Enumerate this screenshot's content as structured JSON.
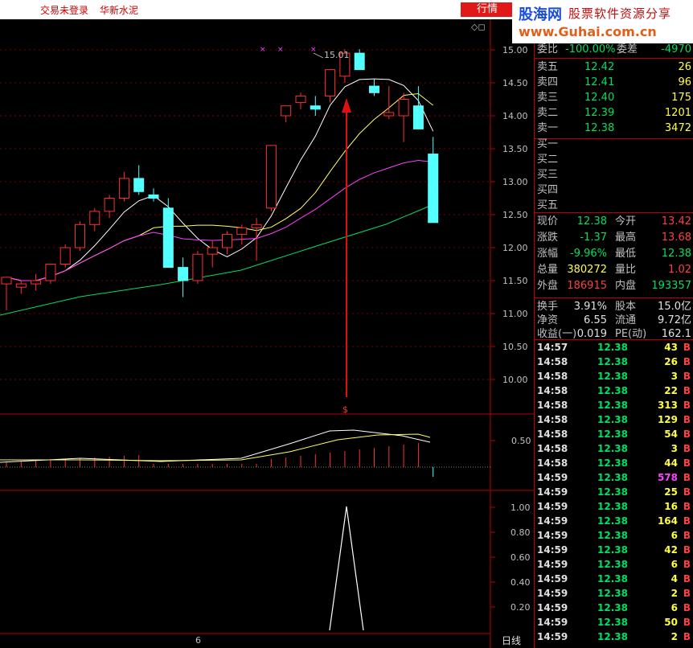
{
  "topbar": {
    "login_status": "交易未登录",
    "stock_name": "华新水泥",
    "button_label": "行情"
  },
  "banner": {
    "logo": "股海网",
    "slogan": "股票软件资源分享",
    "url": "www.Guhai.com.cn"
  },
  "chart": {
    "price_axis": [
      "15.00",
      "14.50",
      "14.00",
      "13.50",
      "13.00",
      "12.50",
      "12.00",
      "11.50",
      "11.00",
      "10.50",
      "10.00"
    ],
    "high_label": "15.01",
    "signal_mark": "$",
    "macd_axis": [
      "0.50"
    ],
    "indicator_axis": [
      "1.00",
      "0.80",
      "0.60",
      "0.40",
      "0.20"
    ],
    "date_label": "6",
    "period_label": "日线",
    "colors": {
      "up": "#ff3030",
      "down": "#54ffff",
      "ma5": "#ffffff",
      "ma10": "#ffff60",
      "ma20": "#ff40ff",
      "ma60": "#00e060"
    }
  },
  "quote": {
    "weibi": {
      "label": "委比",
      "value": "-100.00%",
      "label2": "委差",
      "value2": "-4970"
    },
    "asks": [
      {
        "label": "卖五",
        "price": "12.42",
        "vol": "26"
      },
      {
        "label": "卖四",
        "price": "12.41",
        "vol": "96"
      },
      {
        "label": "卖三",
        "price": "12.40",
        "vol": "175"
      },
      {
        "label": "卖二",
        "price": "12.39",
        "vol": "1201"
      },
      {
        "label": "卖一",
        "price": "12.38",
        "vol": "3472"
      }
    ],
    "bids": [
      {
        "label": "买一"
      },
      {
        "label": "买二"
      },
      {
        "label": "买三"
      },
      {
        "label": "买四"
      },
      {
        "label": "买五"
      }
    ],
    "stats": [
      {
        "l1": "现价",
        "v1": "12.38",
        "l2": "今开",
        "v2": "13.42"
      },
      {
        "l1": "涨跌",
        "v1": "-1.37",
        "l2": "最高",
        "v2": "13.68"
      },
      {
        "l1": "涨幅",
        "v1": "-9.96%",
        "l2": "最低",
        "v2": "12.38"
      },
      {
        "l1": "总量",
        "v1": "380272",
        "l2": "量比",
        "v2": "1.02"
      },
      {
        "l1": "外盘",
        "v1": "186915",
        "l2": "内盘",
        "v2": "193357"
      }
    ],
    "fund": [
      {
        "l1": "换手",
        "v1": "3.91%",
        "l2": "股本",
        "v2": "15.0亿"
      },
      {
        "l1": "净资",
        "v1": "6.55",
        "l2": "流通",
        "v2": "9.72亿"
      },
      {
        "l1": "收益(一)",
        "v1": "0.019",
        "l2": "PE(动)",
        "v2": "162.1"
      }
    ]
  },
  "ticks": [
    {
      "time": "14:57",
      "price": "12.38",
      "vol": "43",
      "side": "B"
    },
    {
      "time": "14:58",
      "price": "12.38",
      "vol": "26",
      "side": "B"
    },
    {
      "time": "14:58",
      "price": "12.38",
      "vol": "3",
      "side": "B"
    },
    {
      "time": "14:58",
      "price": "12.38",
      "vol": "22",
      "side": "B"
    },
    {
      "time": "14:58",
      "price": "12.38",
      "vol": "313",
      "side": "B"
    },
    {
      "time": "14:58",
      "price": "12.38",
      "vol": "129",
      "side": "B"
    },
    {
      "time": "14:58",
      "price": "12.38",
      "vol": "54",
      "side": "B"
    },
    {
      "time": "14:58",
      "price": "12.38",
      "vol": "3",
      "side": "B"
    },
    {
      "time": "14:58",
      "price": "12.38",
      "vol": "44",
      "side": "B"
    },
    {
      "time": "14:59",
      "price": "12.38",
      "vol": "578",
      "side": "B"
    },
    {
      "time": "14:59",
      "price": "12.38",
      "vol": "25",
      "side": "B"
    },
    {
      "time": "14:59",
      "price": "12.38",
      "vol": "16",
      "side": "B"
    },
    {
      "time": "14:59",
      "price": "12.38",
      "vol": "164",
      "side": "B"
    },
    {
      "time": "14:59",
      "price": "12.38",
      "vol": "6",
      "side": "B"
    },
    {
      "time": "14:59",
      "price": "12.38",
      "vol": "42",
      "side": "B"
    },
    {
      "time": "14:59",
      "price": "12.38",
      "vol": "6",
      "side": "B"
    },
    {
      "time": "14:59",
      "price": "12.38",
      "vol": "4",
      "side": "B"
    },
    {
      "time": "14:59",
      "price": "12.38",
      "vol": "2",
      "side": "B"
    },
    {
      "time": "14:59",
      "price": "12.38",
      "vol": "6",
      "side": "B"
    },
    {
      "time": "14:59",
      "price": "12.38",
      "vol": "50",
      "side": "B"
    },
    {
      "time": "14:59",
      "price": "12.38",
      "vol": "2",
      "side": "B"
    }
  ]
}
